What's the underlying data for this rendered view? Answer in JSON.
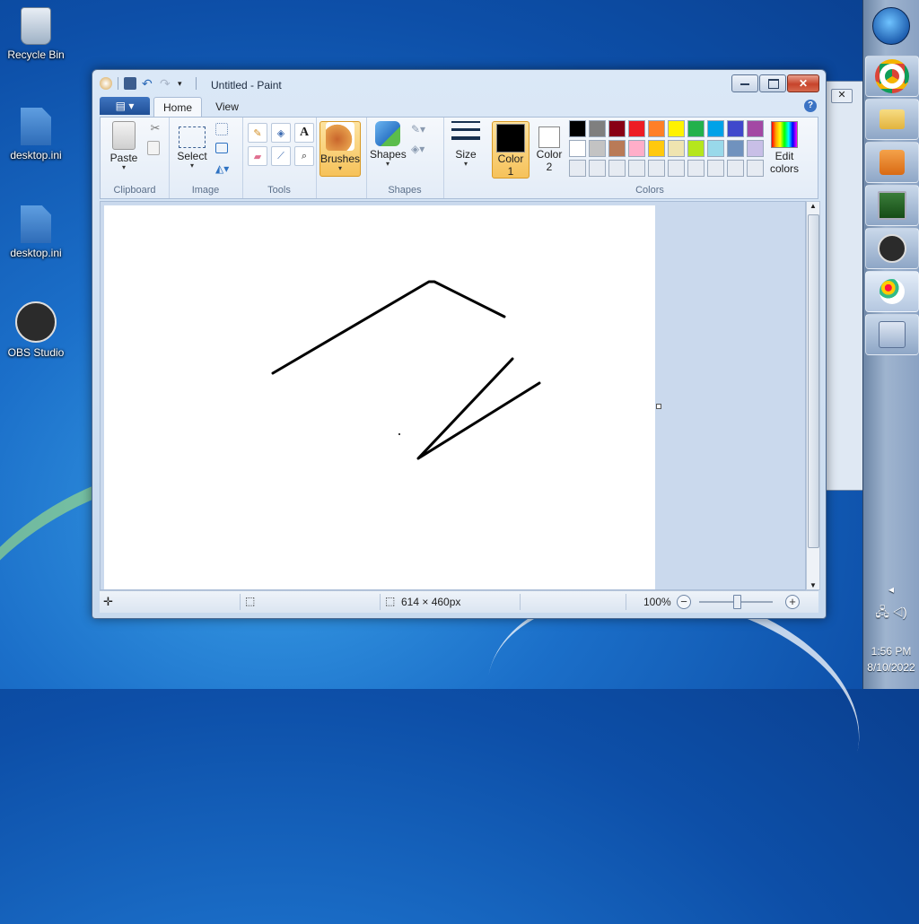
{
  "desktop": {
    "icons": [
      {
        "label": "Recycle Bin",
        "icon": "recycle-bin-icon"
      },
      {
        "label": "desktop.ini",
        "icon": "settings-file-icon"
      },
      {
        "label": "desktop.ini",
        "icon": "settings-file-icon"
      },
      {
        "label": "OBS Studio",
        "icon": "obs-studio-icon"
      }
    ]
  },
  "paint": {
    "title": "Untitled - Paint",
    "tabs": {
      "file": "",
      "home": "Home",
      "view": "View"
    },
    "clipboard": {
      "paste": "Paste",
      "group": "Clipboard"
    },
    "image": {
      "select": "Select",
      "group": "Image"
    },
    "tools": {
      "group": "Tools"
    },
    "brushes": {
      "label": "Brushes"
    },
    "shapes": {
      "label": "Shapes",
      "group": "Shapes"
    },
    "size": {
      "label": "Size"
    },
    "colors": {
      "color1": "Color\n1",
      "color1_l1": "Color",
      "color1_l2": "1",
      "color2_l1": "Color",
      "color2_l2": "2",
      "edit_l1": "Edit",
      "edit_l2": "colors",
      "group": "Colors",
      "color1_value": "#000000",
      "color2_value": "#ffffff",
      "palette_row1": [
        "#000000",
        "#7f7f7f",
        "#880015",
        "#ed1c24",
        "#ff7f27",
        "#fff200",
        "#22b14c",
        "#00a2e8",
        "#3f48cc",
        "#a349a4"
      ],
      "palette_row2": [
        "#ffffff",
        "#c3c3c3",
        "#b97a57",
        "#ffaec9",
        "#ffc90e",
        "#efe4b0",
        "#b5e61d",
        "#99d9ea",
        "#7092be",
        "#c8bfe7"
      ]
    },
    "status": {
      "dimensions": "614 × 460px",
      "zoom": "100%"
    }
  },
  "taskbar": {
    "time": "1:56 PM",
    "date": "8/10/2022"
  }
}
